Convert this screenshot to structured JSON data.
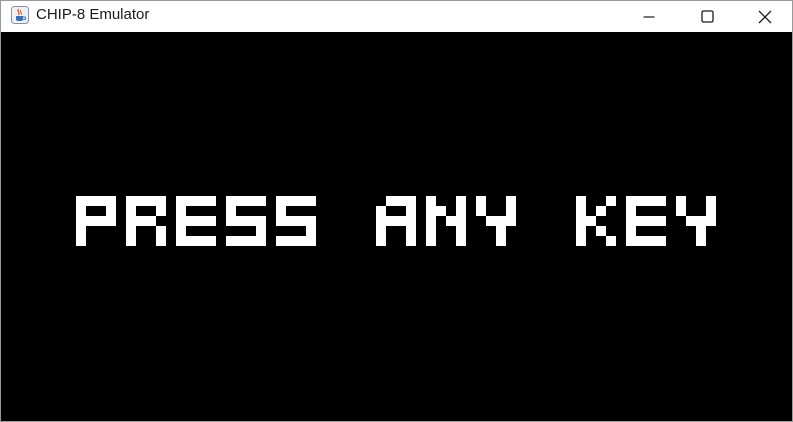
{
  "window": {
    "title": "CHIP-8 Emulator",
    "app_icon": "java-coffee-cup-icon",
    "controls": {
      "minimize_icon": "minimize-icon",
      "maximize_icon": "maximize-icon",
      "close_icon": "close-icon"
    }
  },
  "display": {
    "message": "PRESS ANY KEY",
    "background_color": "#000000",
    "pixel_color": "#ffffff"
  }
}
